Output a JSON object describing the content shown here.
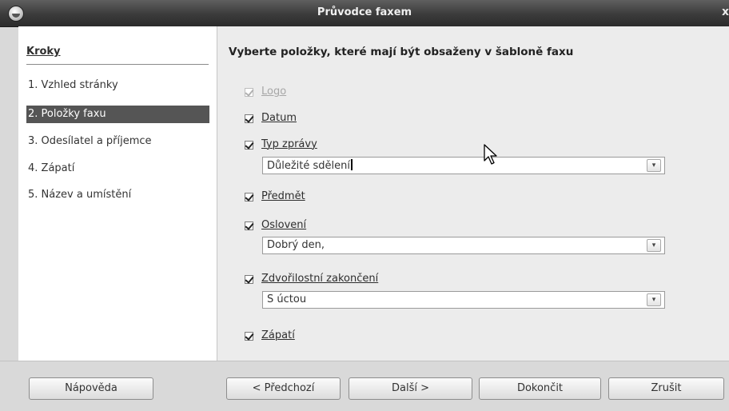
{
  "window": {
    "title": "Průvodce faxem",
    "close_glyph": "x"
  },
  "sidebar": {
    "heading": "Kroky",
    "steps": [
      {
        "label": "1. Vzhled stránky"
      },
      {
        "label": "2. Položky faxu",
        "active": true
      },
      {
        "label": "3. Odesílatel a příjemce"
      },
      {
        "label": "4. Zápatí"
      },
      {
        "label": "5. Název a umístění"
      }
    ]
  },
  "content": {
    "heading": "Vyberte položky, které mají být obsaženy v šabloně faxu",
    "items": {
      "logo": {
        "label": "Logo",
        "checked": true,
        "enabled": false
      },
      "datum": {
        "label": "Datum",
        "checked": true
      },
      "typ_zpravy": {
        "label": "Typ zprávy",
        "checked": true,
        "combo_value": "Důležité sdělení"
      },
      "predmet": {
        "label": "Předmět",
        "checked": true
      },
      "osloveni": {
        "label": "Oslovení",
        "checked": true,
        "combo_value": "Dobrý den,"
      },
      "zdvorilost": {
        "label": "Zdvořilostní zakončení",
        "checked": true,
        "combo_value": "S úctou"
      },
      "zapati": {
        "label": "Zápatí",
        "checked": true
      }
    },
    "combo_caret_glyph": "▾"
  },
  "buttons": {
    "help": "Nápověda",
    "back": "< Předchozí",
    "next": "Další >",
    "finish": "Dokončit",
    "cancel": "Zrušit"
  },
  "icons": {
    "app": "app-icon",
    "close": "close-icon",
    "checkbox": "checkmark-icon",
    "dropdown": "chevron-down-icon",
    "pointer": "mouse-pointer-icon"
  }
}
